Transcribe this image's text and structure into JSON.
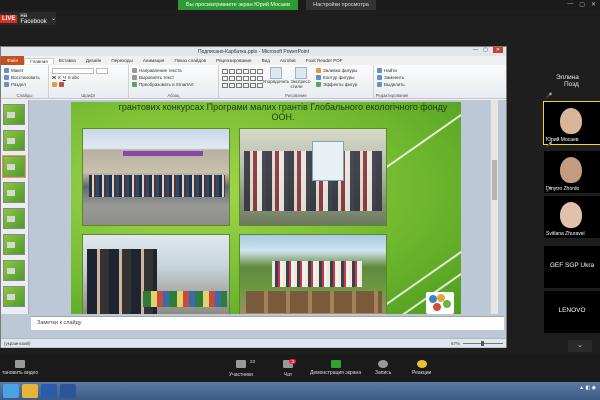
{
  "zoom": {
    "facebook_live": {
      "badge": "LIVE",
      "label": "на Facebook",
      "caret": "⌄"
    },
    "share_banner": "Вы просматриваете экран Юрий Мосаев",
    "view_options": "Настройки просмотра",
    "participants": [
      {
        "name": "Эллина",
        "kind": "text",
        "mic": ""
      },
      {
        "name": "Юрий Мосаев",
        "kind": "face",
        "mic": "🎤"
      },
      {
        "name": "Dmytro Zhordo",
        "kind": "face",
        "mic": "🎤"
      },
      {
        "name": "Svitlana Zhuravel",
        "kind": "face",
        "mic": "🎤"
      },
      {
        "name": "GEF SGP Ukra",
        "kind": "text",
        "mic": ""
      },
      {
        "name": "LENOVO",
        "kind": "text",
        "mic": ""
      }
    ],
    "header_extra": "Позд",
    "more_arrow": "⌄",
    "toolbar": {
      "stop_video": "тановить видео",
      "participants": "Участники",
      "participants_count": "23",
      "chat": "Чат",
      "chat_badge": "3",
      "share": "Демонстрация экрана",
      "record": "Запись",
      "reactions": "Реакции"
    }
  },
  "ppt": {
    "title": "Подписано-Карбатка.pptx - Microsoft PowerPoint",
    "tabs": [
      "Файл",
      "Главная",
      "Вставка",
      "Дизайн",
      "Переходы",
      "Анимация",
      "Показ слайдов",
      "Рецензирование",
      "Вид",
      "Acrobat",
      "Foxit Reader PDF"
    ],
    "ribbon": {
      "slides_group": "Слайды",
      "slides_buttons": [
        "Макет",
        "Восстановить",
        "Раздел"
      ],
      "font_group": "Шрифт",
      "paragraph_group": "Абзац",
      "paragraph_buttons": [
        "Направление текста",
        "Выровнять текст",
        "Преобразовать в SmartArt"
      ],
      "drawing_group": "Рисование",
      "arrange_label": "Упорядочить",
      "quick_styles_label": "Экспресс-стили",
      "shape_buttons": [
        "Заливка фигуры",
        "Контур фигуры",
        "Эффекты фигур"
      ],
      "editing_group": "Редактирование",
      "editing_buttons": [
        "Найти",
        "Заменить",
        "Выделить"
      ]
    },
    "slide_text": "грантових конкурсах Програми малих грантів Глобального екологічного фонду ООН.",
    "notes_placeholder": "Заметки к слайду",
    "status_left": "(украинский)",
    "status_right": "67%"
  }
}
